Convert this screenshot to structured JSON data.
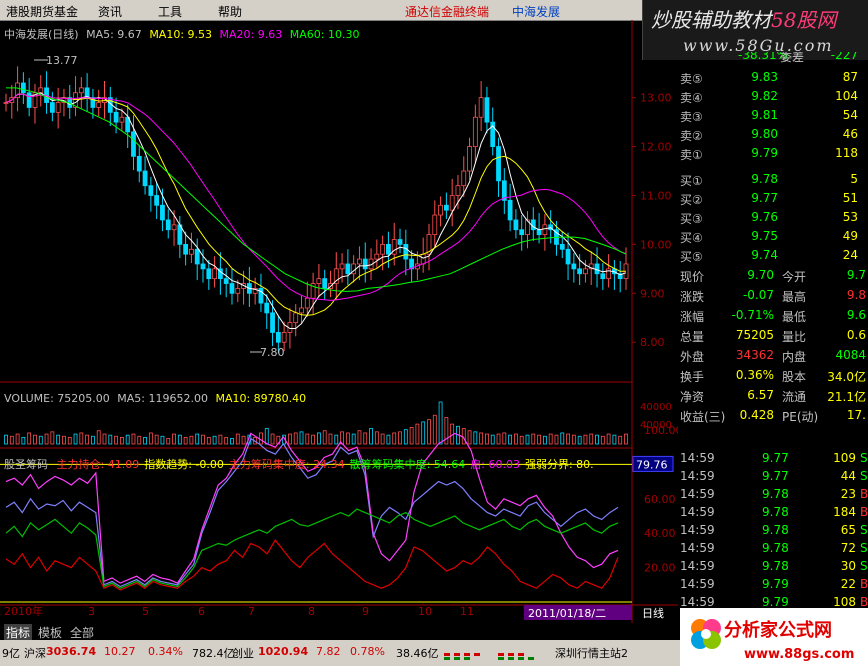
{
  "menu": {
    "items": [
      "港股期货基金",
      "资讯",
      "工具",
      "帮助"
    ],
    "brand": "通达信金融终端",
    "stock_label": "中海发展"
  },
  "watermark": {
    "line1": "炒股辅助教材",
    "line1_accent": "58股网",
    "line2": "www.58Gu.com"
  },
  "main_chart": {
    "title": "中海发展(日线)",
    "ma5_label": "MA5: 9.67",
    "ma10_label": "MA10: 9.53",
    "ma20_label": "MA20: 9.63",
    "ma60_label": "MA60: 10.30",
    "high_marker": "13.77",
    "low_marker": "7.80",
    "y_ticks": [
      "13.00",
      "12.00",
      "11.00",
      "10.00",
      "9.00",
      "8.00"
    ],
    "colors": {
      "ma5": "#ffffff",
      "ma10": "#ffff00",
      "ma20": "#ff00ff",
      "ma60": "#00ff00"
    }
  },
  "volume_panel": {
    "label": "VOLUME: 75205.00",
    "ma5": "MA5: 119652.00",
    "ma10": "MA10: 89780.40",
    "y_ticks": [
      "40000",
      "40000"
    ]
  },
  "indicator_panel": {
    "name": "股圣筹码",
    "items": [
      {
        "label": "主力持仓: 41.09",
        "color": "#ff3030"
      },
      {
        "label": "指数趋势: -0.00",
        "color": "#ffff00"
      },
      {
        "label": "主力筹码集中度: 24.34",
        "color": "#ff3030"
      },
      {
        "label": "散筹筹码集中度: 54.64",
        "color": "#00ff00"
      },
      {
        "label": "启: 60.03",
        "color": "#ff00ff"
      },
      {
        "label": "强弱分界: 80.",
        "color": "#ffff00"
      }
    ],
    "y_ticks": [
      "100.00",
      "60.00",
      "40.00",
      "20.00"
    ],
    "cursor_value": "79.76"
  },
  "x_axis": {
    "labels": [
      "2010年",
      "3",
      "5",
      "6",
      "7",
      "8",
      "9",
      "10",
      "11",
      "12"
    ],
    "cursor_date": "2011/01/18/二",
    "period": "日线"
  },
  "order_book": {
    "header": {
      "left_value": "-38.31%",
      "right_label": "委差",
      "right_value": "-227"
    },
    "asks": [
      {
        "label": "卖⑤",
        "price": "9.83",
        "vol": "87"
      },
      {
        "label": "卖④",
        "price": "9.82",
        "vol": "104"
      },
      {
        "label": "卖③",
        "price": "9.81",
        "vol": "54"
      },
      {
        "label": "卖②",
        "price": "9.80",
        "vol": "46"
      },
      {
        "label": "卖①",
        "price": "9.79",
        "vol": "118"
      }
    ],
    "bids": [
      {
        "label": "买①",
        "price": "9.78",
        "vol": "5"
      },
      {
        "label": "买②",
        "price": "9.77",
        "vol": "51"
      },
      {
        "label": "买③",
        "price": "9.76",
        "vol": "53"
      },
      {
        "label": "买④",
        "price": "9.75",
        "vol": "49"
      },
      {
        "label": "买⑤",
        "price": "9.74",
        "vol": "24"
      }
    ]
  },
  "stats": [
    {
      "l1": "现价",
      "v1": "9.70",
      "l2": "今开",
      "v2": "9.7",
      "c1": "#00ff00",
      "c2": "#00ff00"
    },
    {
      "l1": "涨跌",
      "v1": "-0.07",
      "l2": "最高",
      "v2": "9.8",
      "c1": "#00ff00",
      "c2": "#ff3030"
    },
    {
      "l1": "涨幅",
      "v1": "-0.71%",
      "l2": "最低",
      "v2": "9.6",
      "c1": "#00ff00",
      "c2": "#00ff00"
    },
    {
      "l1": "总量",
      "v1": "75205",
      "l2": "量比",
      "v2": "0.6",
      "c1": "#ffff00",
      "c2": "#ffff00"
    },
    {
      "l1": "外盘",
      "v1": "34362",
      "l2": "内盘",
      "v2": "4084",
      "c1": "#ff3030",
      "c2": "#00ff00"
    },
    {
      "l1": "换手",
      "v1": "0.36%",
      "l2": "股本",
      "v2": "34.0亿",
      "c1": "#ffff00",
      "c2": "#ffff00"
    },
    {
      "l1": "净资",
      "v1": "6.57",
      "l2": "流通",
      "v2": "21.1亿",
      "c1": "#ffff00",
      "c2": "#ffff00"
    },
    {
      "l1": "收益(三)",
      "v1": "0.428",
      "l2": "PE(动)",
      "v2": "17.",
      "c1": "#ffff00",
      "c2": "#ffff00"
    }
  ],
  "ticks": [
    {
      "time": "14:59",
      "price": "9.77",
      "vol": "109",
      "flag": "S"
    },
    {
      "time": "14:59",
      "price": "9.77",
      "vol": "44",
      "flag": "S"
    },
    {
      "time": "14:59",
      "price": "9.78",
      "vol": "23",
      "flag": "B"
    },
    {
      "time": "14:59",
      "price": "9.78",
      "vol": "184",
      "flag": "B"
    },
    {
      "time": "14:59",
      "price": "9.78",
      "vol": "65",
      "flag": "S"
    },
    {
      "time": "14:59",
      "price": "9.78",
      "vol": "72",
      "flag": "S"
    },
    {
      "time": "14:59",
      "price": "9.78",
      "vol": "30",
      "flag": "S"
    },
    {
      "time": "14:59",
      "price": "9.79",
      "vol": "22",
      "flag": "B"
    },
    {
      "time": "14:59",
      "price": "9.79",
      "vol": "108",
      "flag": "B"
    },
    {
      "time": "14:59",
      "price": "9.79",
      "vol": "79",
      "flag": "S"
    }
  ],
  "tabs": [
    "指标",
    "模板",
    "全部"
  ],
  "status": {
    "a": "9亿",
    "sh_label": "沪深",
    "sh_value": "3036.74",
    "sh_change": "10.27",
    "sh_pct": "0.34%",
    "sh_amount": "782.4亿",
    "cy_label": "创业",
    "cy_value": "1020.94",
    "cy_change": "7.82",
    "cy_pct": "0.78%",
    "cy_amount": "38.46亿",
    "server": "深圳行情主站2"
  },
  "logo": {
    "name": "分析家公式网",
    "url": "www.88gs.com"
  },
  "series": {
    "close": [
      12.9,
      13.0,
      13.3,
      13.1,
      12.8,
      13.1,
      13.2,
      12.9,
      12.7,
      12.9,
      13.0,
      12.8,
      13.1,
      13.2,
      13.0,
      12.8,
      12.9,
      13.0,
      12.7,
      12.5,
      12.6,
      12.3,
      11.8,
      11.5,
      11.2,
      11.0,
      10.8,
      10.5,
      10.3,
      10.4,
      10.0,
      9.8,
      9.9,
      9.6,
      9.5,
      9.3,
      9.5,
      9.3,
      9.2,
      9.0,
      9.1,
      9.2,
      9.0,
      9.1,
      8.8,
      8.6,
      8.2,
      8.0,
      8.2,
      8.4,
      8.6,
      8.7,
      8.9,
      9.2,
      9.3,
      9.1,
      9.2,
      9.5,
      9.6,
      9.4,
      9.6,
      9.7,
      9.5,
      9.7,
      9.8,
      10.0,
      9.8,
      10.1,
      10.0,
      9.7,
      9.5,
      9.6,
      9.8,
      10.2,
      10.6,
      10.8,
      10.7,
      11.0,
      11.2,
      11.5,
      12.0,
      12.6,
      13.0,
      12.5,
      12.0,
      11.3,
      10.9,
      10.5,
      10.3,
      10.2,
      10.5,
      10.3,
      10.2,
      10.4,
      10.3,
      10.0,
      9.9,
      9.6,
      9.5,
      9.4,
      9.5,
      9.6,
      9.4,
      9.3,
      9.5,
      9.4,
      9.3,
      9.6
    ],
    "ma60": [
      13.2,
      13.2,
      13.15,
      13.1,
      13.0,
      12.95,
      12.9,
      12.8,
      12.7,
      12.6,
      12.5,
      12.35,
      12.2,
      12.0,
      11.8,
      11.6,
      11.4,
      11.2,
      11.0,
      10.8,
      10.6,
      10.4,
      10.2,
      10.0,
      9.85,
      9.7,
      9.55,
      9.4,
      9.3,
      9.2,
      9.12,
      9.08,
      9.05,
      9.04,
      9.05,
      9.1,
      9.12,
      9.15,
      9.18,
      9.22,
      9.25,
      9.3,
      9.35,
      9.4,
      9.5,
      9.6,
      9.7,
      9.8,
      9.9,
      9.98,
      10.05,
      10.1,
      10.12,
      10.14,
      10.15,
      10.15,
      10.12,
      10.05,
      9.98,
      9.9,
      9.8
    ],
    "vol": [
      8,
      7,
      9,
      6,
      10,
      8,
      7,
      9,
      11,
      8,
      7,
      6,
      9,
      10,
      8,
      7,
      12,
      9,
      8,
      7,
      6,
      8,
      9,
      7,
      6,
      10,
      8,
      7,
      5,
      9,
      8,
      6,
      7,
      9,
      8,
      6,
      7,
      8,
      6,
      5,
      9,
      7,
      8,
      6,
      10,
      14,
      9,
      7,
      8,
      9,
      10,
      11,
      9,
      8,
      10,
      12,
      9,
      8,
      11,
      10,
      9,
      12,
      10,
      14,
      11,
      9,
      8,
      10,
      11,
      13,
      15,
      18,
      20,
      22,
      26,
      38,
      24,
      18,
      16,
      14,
      12,
      11,
      10,
      9,
      8,
      9,
      10,
      8,
      9,
      7,
      8,
      9,
      8,
      7,
      9,
      8,
      10,
      9,
      8,
      7,
      8,
      9,
      8,
      7,
      9,
      8,
      7,
      9
    ],
    "ind_purple": [
      70,
      72,
      68,
      74,
      66,
      70,
      73,
      71,
      68,
      72,
      69,
      75,
      12,
      14,
      11,
      13,
      15,
      12,
      16,
      14,
      13,
      11,
      18,
      25,
      42,
      55,
      68,
      72,
      80,
      86,
      98,
      95,
      92,
      90,
      96,
      88,
      82,
      76,
      78,
      84,
      86,
      93,
      88,
      90,
      78,
      40,
      28,
      24,
      30,
      36,
      64,
      80,
      86,
      92,
      95,
      98,
      96,
      88,
      72,
      58,
      54,
      60,
      58,
      56,
      60,
      62,
      55,
      50,
      40,
      32,
      26,
      24,
      20,
      22,
      28,
      30
    ],
    "ind_blue": [
      55,
      58,
      52,
      60,
      54,
      57,
      56,
      59,
      53,
      58,
      55,
      52,
      10,
      12,
      9,
      11,
      13,
      10,
      14,
      12,
      11,
      10,
      16,
      22,
      40,
      52,
      65,
      70,
      76,
      82,
      95,
      92,
      88,
      86,
      92,
      84,
      78,
      72,
      74,
      80,
      82,
      90,
      86,
      88,
      74,
      38,
      50,
      55,
      52,
      48,
      58,
      62,
      66,
      70,
      68,
      70,
      66,
      60,
      56,
      52,
      50,
      54,
      52,
      50,
      56,
      58,
      52,
      48,
      44,
      48,
      52,
      54,
      50,
      48,
      52,
      55
    ],
    "ind_green": [
      40,
      44,
      38,
      46,
      42,
      45,
      48,
      44,
      40,
      46,
      43,
      39,
      9,
      11,
      8,
      10,
      12,
      9,
      13,
      11,
      10,
      9,
      14,
      20,
      30,
      32,
      34,
      33,
      36,
      38,
      40,
      42,
      40,
      44,
      46,
      48,
      45,
      44,
      46,
      48,
      50,
      52,
      50,
      54,
      52,
      50,
      48,
      46,
      50,
      52,
      48,
      46,
      44,
      46,
      48,
      50,
      46,
      44,
      42,
      44,
      46,
      48,
      44,
      42,
      46,
      48,
      44,
      42,
      40,
      42,
      44,
      46,
      42,
      40,
      44,
      46
    ],
    "ind_red": [
      25,
      22,
      28,
      20,
      26,
      18,
      24,
      22,
      20,
      26,
      22,
      18,
      8,
      10,
      7,
      9,
      11,
      8,
      12,
      10,
      9,
      8,
      12,
      15,
      20,
      18,
      22,
      24,
      30,
      26,
      34,
      32,
      28,
      36,
      30,
      24,
      20,
      26,
      30,
      34,
      28,
      24,
      20,
      16,
      12,
      10,
      8,
      10,
      14,
      20,
      32,
      30,
      26,
      22,
      18,
      20,
      24,
      22,
      26,
      32,
      28,
      22,
      18,
      12,
      10,
      8,
      12,
      16,
      14,
      10,
      8,
      12,
      10,
      8,
      14,
      26
    ]
  }
}
